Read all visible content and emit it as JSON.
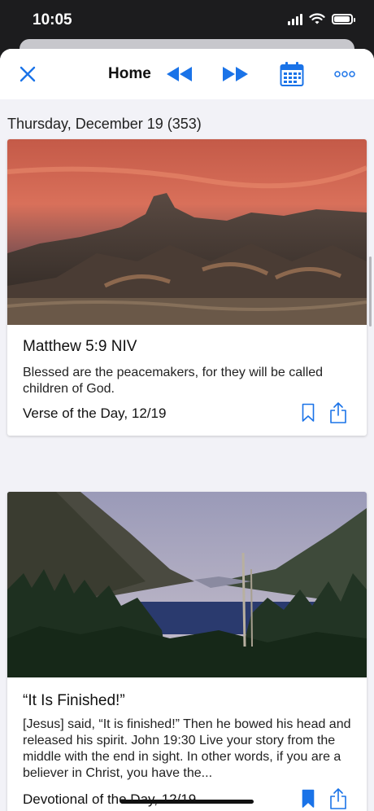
{
  "status_bar": {
    "time": "10:05"
  },
  "toolbar": {
    "title": "Home",
    "close_icon": "close-icon",
    "rewind_icon": "rewind-icon",
    "fast_forward_icon": "fast-forward-icon",
    "calendar_icon": "calendar-icon",
    "more_icon": "more-icon",
    "accent_color": "#1a73e8"
  },
  "content": {
    "date_header": "Thursday, December 19 (353)",
    "cards": [
      {
        "title": "Matthew 5:9 NIV",
        "text": "Blessed are the peacemakers, for they will be called children of God.",
        "footer": "Verse of the Day, 12/19",
        "bookmarked": false
      },
      {
        "title": "“It Is Finished!”",
        "text": "[Jesus] said, “It is finished!” Then he bowed his head and released his spirit. John 19:30 Live your story from the middle with the end in sight. In other words, if you are a believer in Christ, you have the...",
        "footer": "Devotional of the Day, 12/19",
        "bookmarked": true
      }
    ]
  }
}
